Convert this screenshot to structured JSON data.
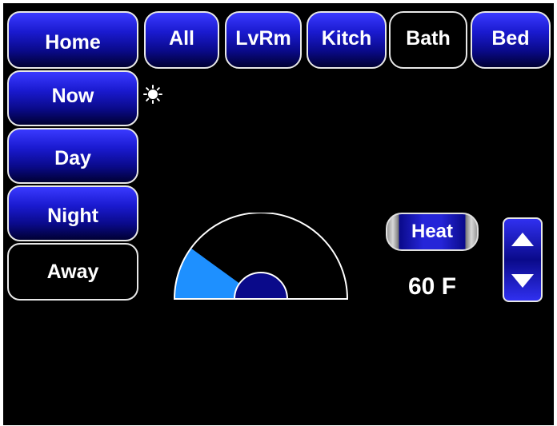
{
  "nav": {
    "home": "Home",
    "rooms": [
      "All",
      "LvRm",
      "Kitch",
      "Bath",
      "Bed"
    ],
    "active_room": "Bath"
  },
  "modes": [
    "Now",
    "Day",
    "Night",
    "Away"
  ],
  "active_mode": "Away",
  "weather_icon": "sun-icon",
  "thermostat": {
    "mode_label": "Heat",
    "setpoint_display": "60 F",
    "gauge_fill_fraction": 0.2
  },
  "stepper": {
    "up_icon": "triangle-up-icon",
    "down_icon": "triangle-down-icon"
  },
  "colors": {
    "accent": "#1e90ff",
    "button_blue": "#1a1ad0",
    "gauge_hub": "#0a0a8a",
    "background": "#000000"
  }
}
